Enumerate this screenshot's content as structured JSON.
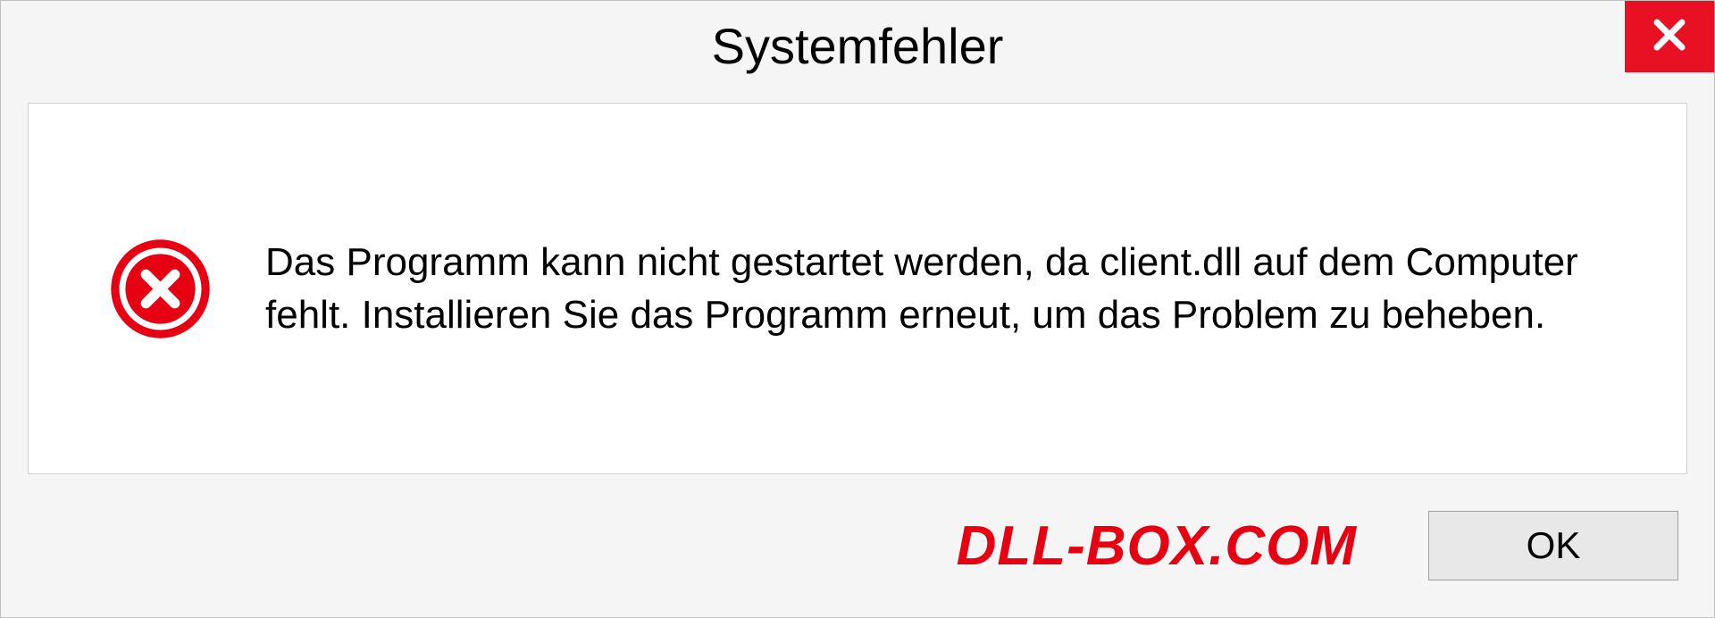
{
  "titlebar": {
    "title": "Systemfehler"
  },
  "content": {
    "message": "Das Programm kann nicht gestartet werden, da client.dll auf dem Computer fehlt. Installieren Sie das Programm erneut, um das Problem zu beheben."
  },
  "footer": {
    "watermark": "DLL-BOX.COM",
    "ok_label": "OK"
  }
}
